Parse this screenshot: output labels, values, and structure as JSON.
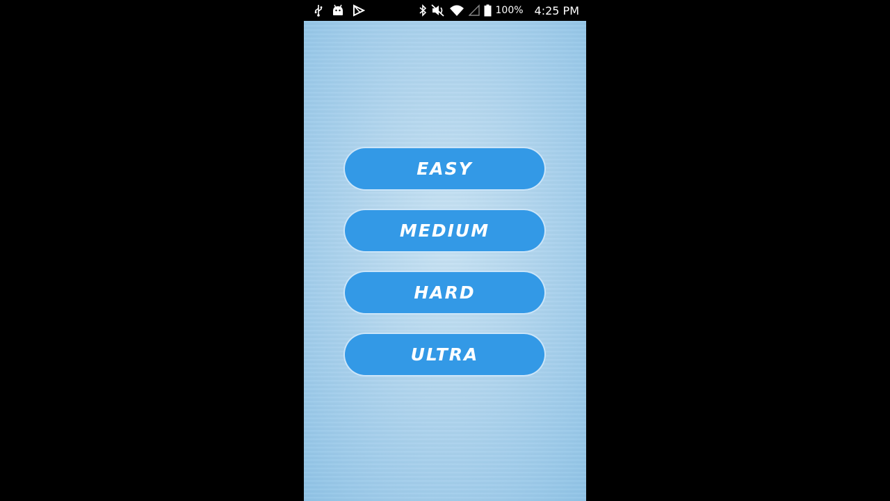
{
  "status_bar": {
    "battery_percent": "100%",
    "time": "4:25 PM",
    "icons": [
      "usb-icon",
      "android-icon",
      "play-store-icon",
      "bluetooth-icon",
      "mute-icon",
      "wifi-icon",
      "signal-icon",
      "battery-icon"
    ],
    "icon_color": "#ffffff"
  },
  "difficulty_menu": {
    "buttons": [
      {
        "label": "EASY"
      },
      {
        "label": "MEDIUM"
      },
      {
        "label": "HARD"
      },
      {
        "label": "ULTRA"
      }
    ],
    "button_color": "#3399e6",
    "text_color": "#ffffff"
  }
}
